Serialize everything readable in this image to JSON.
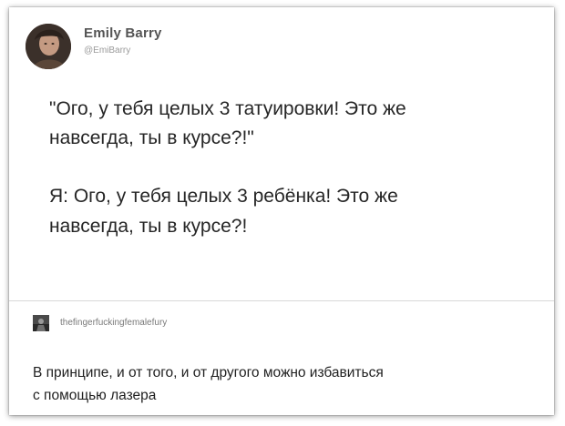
{
  "tweet": {
    "author_name": "Emily Barry",
    "author_handle": "@EmiBarry",
    "avatar_icon": "user-avatar-photo",
    "lines": [
      "\"Ого, у тебя целых 3 татуировки! Это же",
      "навсегда, ты в курсе?!\"",
      "Я: Ого, у тебя целых 3 ребёнка! Это же",
      "навсегда, ты в курсе?!"
    ]
  },
  "reply": {
    "username": "thefingerfuckingfemalefury",
    "avatar_icon": "user-avatar-photo",
    "lines": [
      "В принципе, и от того, и от другого можно избавиться",
      "с помощью лазера"
    ]
  }
}
